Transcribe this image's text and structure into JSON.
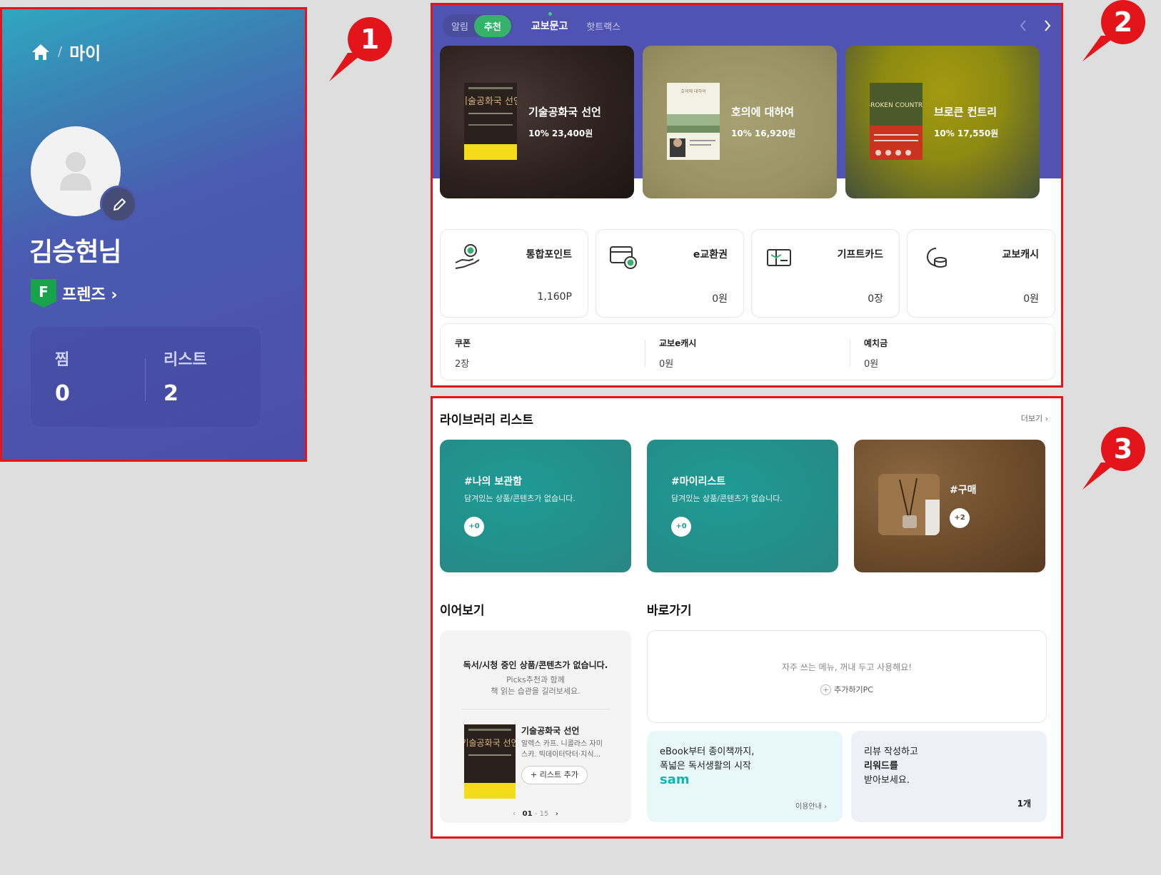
{
  "callouts": [
    "1",
    "2",
    "3"
  ],
  "profile": {
    "breadcrumb_sep": "/",
    "breadcrumb_current": "마이",
    "name": "김승현님",
    "grade_letter": "F",
    "grade_label": "프렌즈 ›",
    "stats": [
      {
        "label": "찜",
        "value": "0"
      },
      {
        "label": "리스트",
        "value": "2"
      }
    ]
  },
  "recommend": {
    "pill_tabs": [
      "알림",
      "추천"
    ],
    "active_pill": "추천",
    "main_tab": "교보문고",
    "sub_tab": "핫트랙스",
    "books": [
      {
        "title": "기술공화국 선언",
        "price": "10%  23,400원",
        "cover_text": "기술공화국 선언"
      },
      {
        "title": "호의에 대하여",
        "price": "10%  16,920원",
        "cover_text": "호의에 대하여"
      },
      {
        "title": "브로큰 컨트리",
        "price": "10%  17,550원",
        "cover_text": "BROKEN COUNTRY"
      }
    ]
  },
  "assets": [
    {
      "label": "통합포인트",
      "value": "1,160P",
      "icon": "point-hand-icon"
    },
    {
      "label": "e교환권",
      "value": "0원",
      "icon": "voucher-icon"
    },
    {
      "label": "기프트카드",
      "value": "0장",
      "icon": "giftcard-icon"
    },
    {
      "label": "교보캐시",
      "value": "0원",
      "icon": "cash-icon"
    }
  ],
  "sub_assets": [
    {
      "label": "쿠폰",
      "value": "2장"
    },
    {
      "label": "교보e캐시",
      "value": "0원"
    },
    {
      "label": "예치금",
      "value": "0원"
    }
  ],
  "library": {
    "title": "라이브러리 리스트",
    "more": "더보기 ›",
    "cards": [
      {
        "name": "#나의 보관함",
        "desc": "담겨있는 상품/콘텐츠가 없습니다.",
        "count": "+0"
      },
      {
        "name": "#마이리스트",
        "desc": "담겨있는 상품/콘텐츠가 없습니다.",
        "count": "+0"
      },
      {
        "name": "#구매",
        "desc": "",
        "count": "+2"
      }
    ]
  },
  "continue": {
    "title": "이어보기",
    "empty": "독서/시청 중인 상품/콘텐츠가 없습니다.",
    "hint1": "Picks추천과 함께",
    "hint2": "책 읽는 습관을 길러보세요.",
    "book_title": "기술공화국 선언",
    "book_authors": "알렉스 카프. 니콜라스 자미스카. 빅데이터닥터·지식...",
    "add_label": "+ 리스트 추가",
    "pager_current": "01",
    "pager_total": "15"
  },
  "shortcut": {
    "title": "바로가기",
    "message": "자주 쓰는 메뉴, 꺼내 두고 사용해요!",
    "add_label": "추가하기PC"
  },
  "promos": {
    "sam_line1": "eBook부터 종이책까지,",
    "sam_line2": "폭넓은 독서생활의 시작",
    "sam_logo": "sam",
    "sam_link": "이용안내 ›",
    "review_line1": "리뷰 작성하고",
    "review_line2": "리워드를",
    "review_line3": "받아보세요.",
    "review_count": "1개"
  },
  "colors": {
    "accent_red": "#e3141a",
    "profile_blue": "#4c4ea8",
    "recommend_band": "#5153b3",
    "green_pill": "#35b36b",
    "teal_card": "#238e8a"
  }
}
